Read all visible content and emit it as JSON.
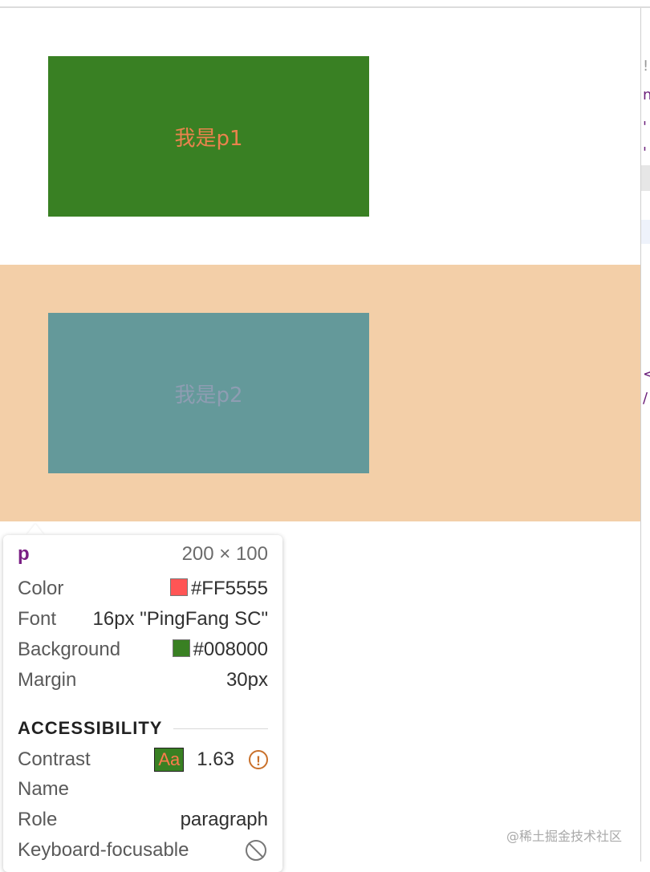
{
  "page": {
    "p1_text": "我是p1",
    "p2_text": "我是p2",
    "colors": {
      "p1_background": "#398023",
      "p1_text": "#e9834d",
      "band_background": "#f3cfa8",
      "p2_background": "#64999a",
      "p2_text": "#8e9db2"
    }
  },
  "tooltip": {
    "tag": "p",
    "dimensions": "200 × 100",
    "props": [
      {
        "label": "Color",
        "value": "#FF5555",
        "swatch": "#ff5555"
      },
      {
        "label": "Font",
        "value": "16px \"PingFang SC\""
      },
      {
        "label": "Background",
        "value": "#008000",
        "swatch": "#398023"
      },
      {
        "label": "Margin",
        "value": "30px"
      }
    ],
    "accessibility": {
      "heading": "ACCESSIBILITY",
      "contrast_label": "Contrast",
      "contrast_sample": "Aa",
      "contrast_value": "1.63",
      "warning_icon": "warning-circle-icon",
      "name_label": "Name",
      "role_label": "Role",
      "role_value": "paragraph",
      "keyboard_label": "Keyboard-focusable",
      "keyboard_icon": "not-allowed-icon"
    }
  },
  "watermark": "@稀土掘金技术社区",
  "devtools_edge_glyphs": [
    "!",
    "n",
    "'",
    "<",
    "/"
  ]
}
